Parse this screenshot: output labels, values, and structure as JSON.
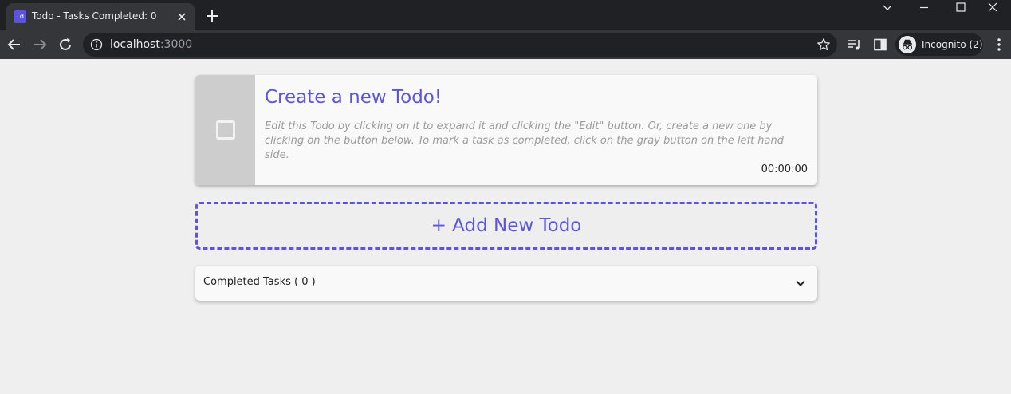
{
  "browser": {
    "tab": {
      "favicon_text": "Td",
      "title": "Todo - Tasks Completed: 0"
    },
    "url": {
      "host": "localhost",
      "port": ":3000"
    },
    "profile": {
      "label": "Incognito (2)"
    }
  },
  "todo": {
    "title": "Create a new Todo!",
    "description": "Edit this Todo by clicking on it to expand it and clicking the \"Edit\" button. Or, create a new one by clicking on the button below. To mark a task as completed, click on the gray button on the left hand side.",
    "timer": "00:00:00",
    "completed": false
  },
  "add_button": {
    "label": "+ Add New Todo"
  },
  "completed_section": {
    "label": "Completed Tasks ( 0 )"
  },
  "colors": {
    "accent": "#5b54e0",
    "sidebar": "#cdcdcd",
    "background": "#efefef"
  }
}
